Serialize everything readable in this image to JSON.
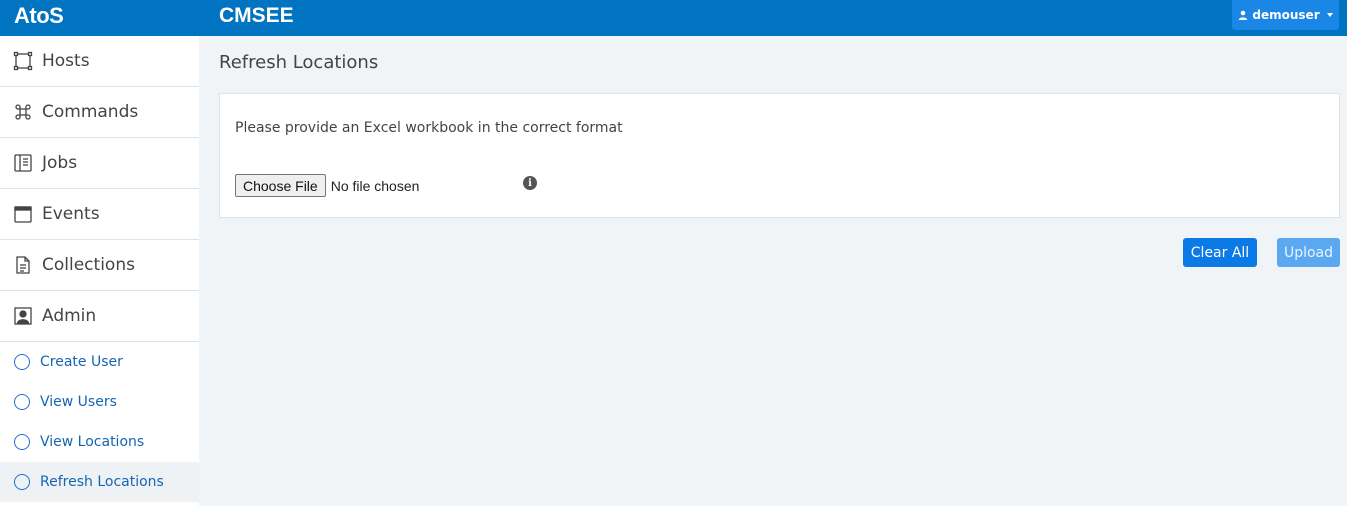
{
  "header": {
    "logo": "AtoS",
    "app_title": "CMSEE",
    "user": "demouser"
  },
  "sidebar": {
    "items": [
      {
        "label": "Hosts",
        "icon": "hosts-icon"
      },
      {
        "label": "Commands",
        "icon": "command-icon"
      },
      {
        "label": "Jobs",
        "icon": "jobs-icon"
      },
      {
        "label": "Events",
        "icon": "calendar-icon"
      },
      {
        "label": "Collections",
        "icon": "document-icon"
      },
      {
        "label": "Admin",
        "icon": "user-square-icon"
      }
    ],
    "admin_subitems": [
      {
        "label": "Create User"
      },
      {
        "label": "View Users"
      },
      {
        "label": "View Locations"
      },
      {
        "label": "Refresh Locations",
        "active": true
      }
    ]
  },
  "main": {
    "title": "Refresh Locations",
    "instruction": "Please provide an Excel workbook in the correct format",
    "file_input": {
      "button_label": "Choose File",
      "status": "No file chosen"
    },
    "buttons": {
      "clear_all": "Clear All",
      "upload": "Upload"
    }
  },
  "colors": {
    "header_bg": "#0073c1",
    "primary_button": "#0b7ae6",
    "disabled_button": "#5aa9f0",
    "link": "#1565b3"
  }
}
